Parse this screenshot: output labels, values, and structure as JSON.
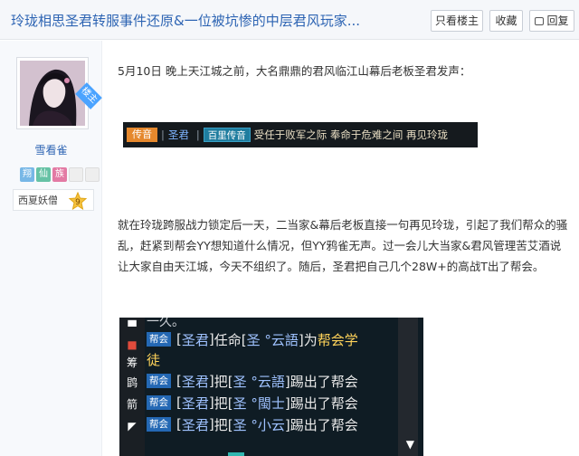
{
  "header": {
    "title": "玲珑相思圣君转服事件还原&一位被坑惨的中层君风玩家...",
    "only_lz": "只看楼主",
    "favorite": "收藏",
    "reply": "回复"
  },
  "user": {
    "ribbon": "楼主",
    "name": "雪看雀",
    "badges": [
      "翔",
      "仙",
      "族"
    ],
    "rank": "西夏妖僧",
    "level": "9"
  },
  "post": {
    "p1": "5月10日 晚上天江城之前，大名鼎鼎的君风临江山幕后老板圣君发声：",
    "p2": "就在玲珑跨服战力锁定后一天，二当家&幕后老板直接一句再见玲珑，引起了我们帮众的骚乱，赶紧到帮会YY想知道什么情况，但YY鸦雀无声。过一会儿大当家&君风管理苦艾酒说让大家自由天江城，今天不组织了。随后，圣君把自己几个28W+的高战T出了帮会。"
  },
  "game_msg1": {
    "chip": "传音",
    "sep": "|",
    "name": "圣君",
    "chip2": "百里传音",
    "text": "受任于败军之际  奉命于危难之间  再见玲珑"
  },
  "game_msg2": {
    "top_frag": "一久。",
    "side_icons": [
      "▀",
      "■",
      "筹",
      "鹍",
      "箭",
      "◤"
    ],
    "rows": [
      {
        "chip": "帮会",
        "open": "[",
        "who": "圣君",
        "close": "]",
        "act": "任命[",
        "target": "圣 °云語",
        "end": "]为",
        "tail": "帮会学"
      },
      {
        "tail2": "徒"
      },
      {
        "chip": "帮会",
        "open": "[",
        "who": "圣君",
        "close": "]",
        "act": "把[",
        "target": "圣 °云語",
        "end": "]踢出了帮会"
      },
      {
        "chip": "帮会",
        "open": "[",
        "who": "圣君",
        "close": "]",
        "act": "把[",
        "target": "圣 °閩士",
        "end": "]踢出了帮会"
      },
      {
        "chip": "帮会",
        "open": "[",
        "who": "圣君",
        "close": "]",
        "act": "把[",
        "target": "圣 °小云",
        "end": "]踢出了帮会"
      }
    ]
  },
  "colors": {
    "link_blue": "#2d64b3",
    "game_bg": "#0f1c24",
    "chip_orange": "#e5882d",
    "chip_blue": "#2468b4"
  }
}
